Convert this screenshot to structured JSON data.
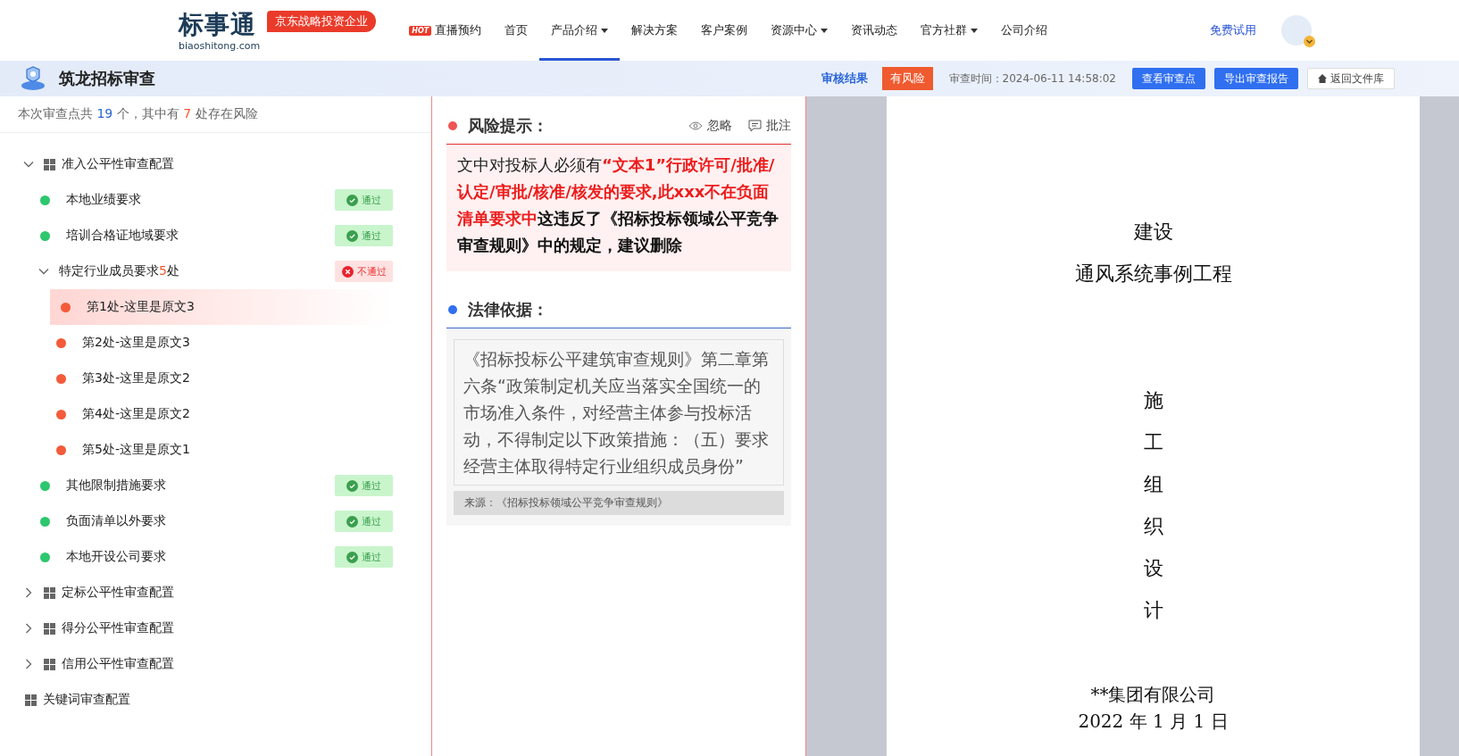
{
  "header": {
    "logo_text": "标事通",
    "logo_domain": "biaoshitong.com",
    "logo_badge": "京东战略投资企业",
    "nav": [
      {
        "label": "直播预约",
        "hot": "HOT",
        "dropdown": false,
        "selected": false
      },
      {
        "label": "首页",
        "dropdown": false,
        "selected": false
      },
      {
        "label": "产品介绍",
        "dropdown": true,
        "selected": true
      },
      {
        "label": "解决方案",
        "dropdown": false,
        "selected": false
      },
      {
        "label": "客户案例",
        "dropdown": false,
        "selected": false
      },
      {
        "label": "资源中心",
        "dropdown": true,
        "selected": false
      },
      {
        "label": "资讯动态",
        "dropdown": false,
        "selected": false
      },
      {
        "label": "官方社群",
        "dropdown": true,
        "selected": false
      },
      {
        "label": "公司介绍",
        "dropdown": false,
        "selected": false
      }
    ],
    "trial": "免费试用"
  },
  "toolbar": {
    "title": "筑龙招标审查",
    "result_label": "审核结果",
    "result_badge": "有风险",
    "time_label": "审查时间：",
    "time": "2024-06-11 14:58:02",
    "buttons": [
      {
        "label": "查看审查点",
        "kind": "primary"
      },
      {
        "label": "导出审查报告",
        "kind": "primary"
      },
      {
        "label": "返回文件库",
        "kind": "home"
      }
    ]
  },
  "summary": [
    {
      "text": "本次审查点共 ",
      "kind": "plain"
    },
    {
      "text": "19",
      "kind": "total"
    },
    {
      "text": " 个，其中有 ",
      "kind": "plain"
    },
    {
      "text": "7",
      "kind": "risk"
    },
    {
      "text": " 处存在风险",
      "kind": "plain"
    }
  ],
  "tree": [
    {
      "label": "准入公平性审查配置",
      "kind": "group",
      "expanded": true,
      "children": [
        {
          "label": "本地业绩要求",
          "kind": "check",
          "color": "#2dc76d",
          "status": {
            "kind": "pass",
            "label": "通过"
          }
        },
        {
          "label": "培训合格证地域要求",
          "kind": "check",
          "color": "#2dc76d",
          "status": {
            "kind": "pass",
            "label": "通过"
          }
        },
        {
          "label": "特定行业成员要求",
          "count": "5",
          "suffix": "处",
          "kind": "subgroup",
          "expanded": true,
          "status": {
            "kind": "fail",
            "label": "不通过"
          },
          "children": [
            {
              "label": "第1处-这里是原文3",
              "kind": "risk",
              "color": "#f45b3a",
              "selected": true
            },
            {
              "label": "第2处-这里是原文3",
              "kind": "risk",
              "color": "#f45b3a",
              "selected": false
            },
            {
              "label": "第3处-这里是原文2",
              "kind": "risk",
              "color": "#f45b3a",
              "selected": false
            },
            {
              "label": "第4处-这里是原文2",
              "kind": "risk",
              "color": "#f45b3a",
              "selected": false
            },
            {
              "label": "第5处-这里是原文1",
              "kind": "risk",
              "color": "#f45b3a",
              "selected": false
            }
          ]
        },
        {
          "label": "其他限制措施要求",
          "kind": "check",
          "color": "#2dc76d",
          "status": {
            "kind": "pass",
            "label": "通过"
          }
        },
        {
          "label": "负面清单以外要求",
          "kind": "check",
          "color": "#2dc76d",
          "status": {
            "kind": "pass",
            "label": "通过"
          }
        },
        {
          "label": "本地开设公司要求",
          "kind": "check",
          "color": "#2dc76d",
          "status": {
            "kind": "pass",
            "label": "通过"
          }
        }
      ]
    },
    {
      "label": "定标公平性审查配置",
      "kind": "group",
      "expanded": false
    },
    {
      "label": "得分公平性审查配置",
      "kind": "group",
      "expanded": false
    },
    {
      "label": "信用公平性审查配置",
      "kind": "group",
      "expanded": false
    },
    {
      "label": "关键词审查配置",
      "kind": "leaf"
    }
  ],
  "risk": {
    "title": "风险提示：",
    "actions": [
      {
        "label": "忽略",
        "kind": "ignore"
      },
      {
        "label": "批注",
        "kind": "comment"
      }
    ],
    "text": [
      {
        "text": "文中对投标人必须有",
        "kind": "plain"
      },
      {
        "text": "“文本1”行政许可/批准/认定/审批/核准/核发的要求,此xxx不在负面清单要求中",
        "kind": "highlight"
      },
      {
        "text": "这违反了《招标投标领域公平竞争审查规则》中的规定，建议删除",
        "kind": "bold"
      }
    ]
  },
  "legal": {
    "title": "法律依据：",
    "text": "《招标投标公平建筑审查规则》第二章第六条“政策制定机关应当落实全国统一的市场准入条件，对经营主体参与投标活动，不得制定以下政策措施：（五）要求经营主体取得特定行业组织成员身份”",
    "source": "来源：《招标投标领域公平竞争审查规则》"
  },
  "document": {
    "title_lines": [
      "建设",
      "通风系统事例工程"
    ],
    "vertical_title": "施工组织设计",
    "company": "**集团有限公司",
    "date": "2022 年 1 月 1 日"
  }
}
